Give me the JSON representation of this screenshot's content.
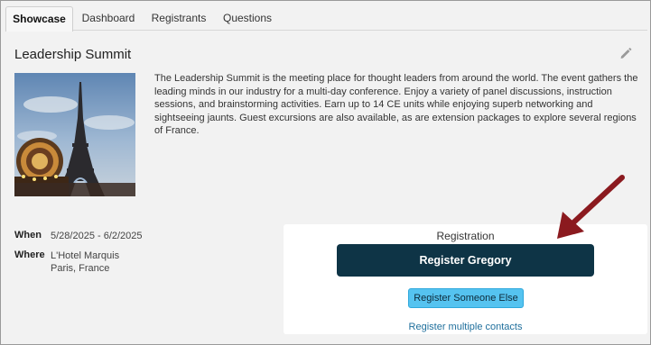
{
  "tabs": [
    {
      "label": "Showcase",
      "active": true
    },
    {
      "label": "Dashboard",
      "active": false
    },
    {
      "label": "Registrants",
      "active": false
    },
    {
      "label": "Questions",
      "active": false
    }
  ],
  "event": {
    "title": "Leadership Summit",
    "description": "The Leadership Summit is the meeting place for thought leaders from around the world. The event gathers the leading minds in our industry for a multi-day conference. Enjoy a variety of panel discussions, instruction sessions, and brainstorming activities. Earn up to 14 CE units while enjoying superb networking and sightseeing jaunts. Guest excursions are also available, as are extension packages to explore several regions of France.",
    "when_label": "When",
    "when_value": "5/28/2025 - 6/2/2025",
    "where_label": "Where",
    "where_line1": "L'Hotel Marquis",
    "where_line2": "Paris, France"
  },
  "registration": {
    "heading": "Registration",
    "primary_button": "Register Gregory",
    "secondary_button": "Register Someone Else",
    "multiple_link": "Register multiple contacts"
  },
  "icons": {
    "edit": "pencil-icon",
    "annotation": "red-arrow"
  },
  "colors": {
    "primary_button": "#0e3446",
    "secondary_button": "#55c3f0",
    "link": "#1f6f9c",
    "arrow": "#8b1a1f"
  }
}
